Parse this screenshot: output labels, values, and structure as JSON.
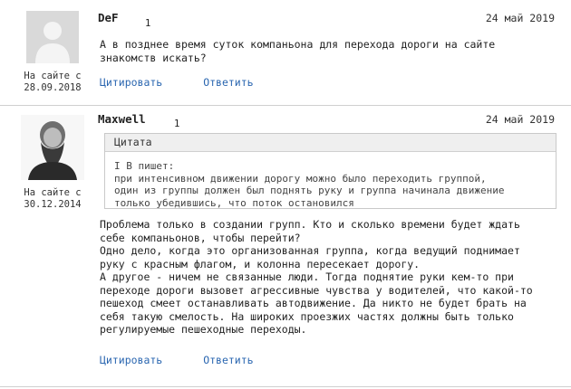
{
  "posts": [
    {
      "author": "DeF",
      "count": "1",
      "date": "24 май 2019",
      "on_site": "На сайте с\n28.09.2018",
      "avatar_icon": "user-silhouette-icon",
      "text": "А в позднее время суток компаньона для перехода дороги на сайте\nзнакомств искать?",
      "quote_label": "Цитировать",
      "reply_label": "Ответить"
    },
    {
      "author": "Maxwell",
      "count": "1",
      "date": "24 май 2019",
      "on_site": "На сайте с\n30.12.2014",
      "avatar_icon": "portrait-photo-icon",
      "quote": {
        "title": "Цитата",
        "text": "I B пишет:\nпри интенсивном движении дорогу можно было переходить группой,\nодин из группы должен был поднять руку и группа начинала движение\nтолько убедившись, что поток остановился"
      },
      "text": "Проблема только в создании групп. Кто и сколько времени будет ждать\nсебе компаньонов, чтобы перейти?\nОдно дело, когда это организованная группа, когда ведущий поднимает\nруку с красным флагом, и колонна пересекает дорогу.\nА другое - ничем не связанные люди. Тогда поднятие руки кем-то при\nпереходе дороги вызовет агрессивные чувства у водителей, что какой-то\nпешеход смеет останавливать автодвижение. Да никто не будет брать на\nсебя такую смелость. На широких проезжих частях должны быть только\nрегулируемые пешеходные переходы.",
      "quote_label": "Цитировать",
      "reply_label": "Ответить"
    }
  ],
  "colors": {
    "link": "#2a66b0",
    "divider": "#cfcfcf",
    "quote_header_bg": "#efefef"
  }
}
